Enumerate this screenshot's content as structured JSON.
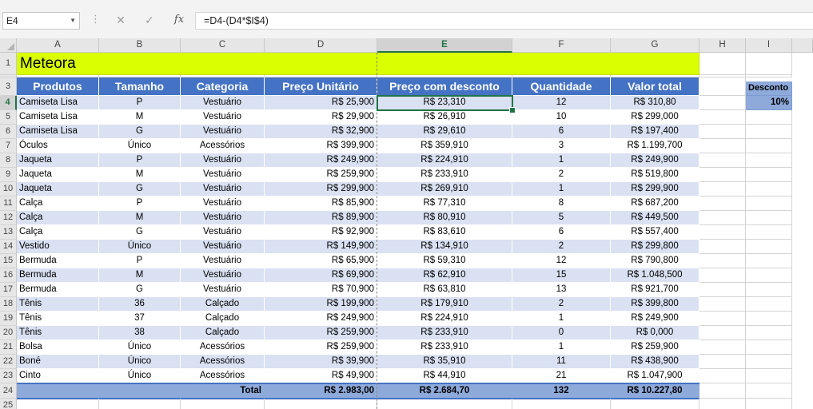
{
  "formula_bar": {
    "name_box": "E4",
    "formula": "=D4-(D4*$I$4)",
    "icons": [
      "cancel-icon",
      "enter-check-icon",
      "insert-function-icon"
    ]
  },
  "columns": [
    "A",
    "B",
    "C",
    "D",
    "E",
    "F",
    "G",
    "H",
    "I"
  ],
  "selected_cell": "E4",
  "sheet": {
    "title": "Meteora",
    "headers": [
      "Produtos",
      "Tamanho",
      "Categoria",
      "Preço Unitário",
      "Preço com desconto",
      "Quantidade",
      "Valor total"
    ],
    "rows": [
      [
        "Camiseta Lisa",
        "P",
        "Vestuário",
        "R$ 25,900",
        "R$ 23,310",
        "12",
        "R$ 310,80"
      ],
      [
        "Camiseta Lisa",
        "M",
        "Vestuário",
        "R$ 29,900",
        "R$ 26,910",
        "10",
        "R$ 299,000"
      ],
      [
        "Camiseta Lisa",
        "G",
        "Vestuário",
        "R$ 32,900",
        "R$ 29,610",
        "6",
        "R$ 197,400"
      ],
      [
        "Óculos",
        "Único",
        "Acessórios",
        "R$ 399,900",
        "R$ 359,910",
        "3",
        "R$ 1.199,700"
      ],
      [
        "Jaqueta",
        "P",
        "Vestuário",
        "R$ 249,900",
        "R$ 224,910",
        "1",
        "R$ 249,900"
      ],
      [
        "Jaqueta",
        "M",
        "Vestuário",
        "R$ 259,900",
        "R$ 233,910",
        "2",
        "R$ 519,800"
      ],
      [
        "Jaqueta",
        "G",
        "Vestuário",
        "R$ 299,900",
        "R$ 269,910",
        "1",
        "R$ 299,900"
      ],
      [
        "Calça",
        "P",
        "Vestuário",
        "R$ 85,900",
        "R$ 77,310",
        "8",
        "R$ 687,200"
      ],
      [
        "Calça",
        "M",
        "Vestuário",
        "R$ 89,900",
        "R$ 80,910",
        "5",
        "R$ 449,500"
      ],
      [
        "Calça",
        "G",
        "Vestuário",
        "R$ 92,900",
        "R$ 83,610",
        "6",
        "R$ 557,400"
      ],
      [
        "Vestido",
        "Único",
        "Vestuário",
        "R$ 149,900",
        "R$ 134,910",
        "2",
        "R$ 299,800"
      ],
      [
        "Bermuda",
        "P",
        "Vestuário",
        "R$ 65,900",
        "R$ 59,310",
        "12",
        "R$ 790,800"
      ],
      [
        "Bermuda",
        "M",
        "Vestuário",
        "R$ 69,900",
        "R$ 62,910",
        "15",
        "R$ 1.048,500"
      ],
      [
        "Bermuda",
        "G",
        "Vestuário",
        "R$ 70,900",
        "R$ 63,810",
        "13",
        "R$ 921,700"
      ],
      [
        "Tênis",
        "36",
        "Calçado",
        "R$ 199,900",
        "R$ 179,910",
        "2",
        "R$ 399,800"
      ],
      [
        "Tênis",
        "37",
        "Calçado",
        "R$ 249,900",
        "R$ 224,910",
        "1",
        "R$ 249,900"
      ],
      [
        "Tênis",
        "38",
        "Calçado",
        "R$ 259,900",
        "R$ 233,910",
        "0",
        "R$ 0,000"
      ],
      [
        "Bolsa",
        "Único",
        "Acessórios",
        "R$ 259,900",
        "R$ 233,910",
        "1",
        "R$ 259,900"
      ],
      [
        "Boné",
        "Único",
        "Acessórios",
        "R$ 39,900",
        "R$ 35,910",
        "11",
        "R$ 438,900"
      ],
      [
        "Cinto",
        "Único",
        "Acessórios",
        "R$ 49,900",
        "R$ 44,910",
        "21",
        "R$ 1.047,900"
      ]
    ],
    "total": [
      "",
      "",
      "Total",
      "R$ 2.983,00",
      "R$ 2.684,70",
      "132",
      "R$ 10.227,80"
    ],
    "discount": {
      "label": "Desconto",
      "value": "10%"
    }
  },
  "colors": {
    "title_fill": "#d9ff00",
    "header_fill": "#4472c4",
    "band_fill": "#d9e1f2",
    "total_fill": "#8eaadb",
    "discount_fill": "#8eaadb",
    "selection": "#217346"
  }
}
